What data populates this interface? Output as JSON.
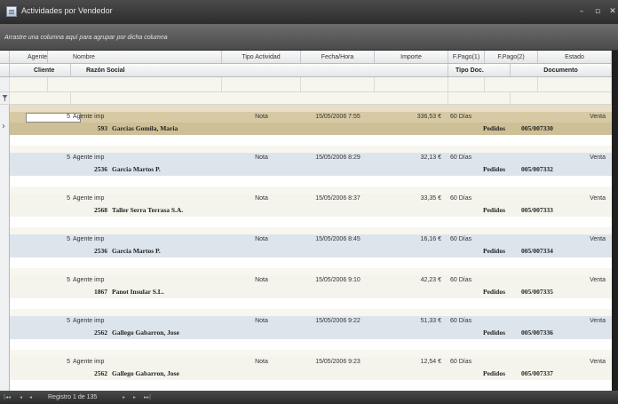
{
  "window": {
    "title": "Actividades por Vendedor",
    "minimize": "–",
    "maximize": "▫",
    "close": "✕"
  },
  "group_panel": {
    "hint": "Arrastre una columna aquí para agrupar por dicha columna"
  },
  "columns": {
    "agente": "Agente",
    "nombre": "Nombre",
    "tipo_actividad": "Tipo Actividad",
    "fecha_hora": "Fecha/Hora",
    "importe": "Importe",
    "fpago1": "F.Pago(1)",
    "fpago2": "F.Pago(2)",
    "estado": "Estado",
    "cliente": "Cliente",
    "razon_social": "Razón Social",
    "tipo_doc": "Tipo Doc.",
    "documento": "Documento"
  },
  "filter_icon": "filter-icon",
  "rows": [
    {
      "agente": "5",
      "nombre": "Agente imp",
      "tipo": "Nota",
      "fecha": "15/05/2006 7:55",
      "importe": "336,53 €",
      "fpago1": "60 Días",
      "fpago2": "",
      "estado": "Venta",
      "cliente": "593",
      "razon": "Garcias Gomila, Maria",
      "tipodoc": "Pedidos",
      "documento": "005/007330"
    },
    {
      "agente": "5",
      "nombre": "Agente imp",
      "tipo": "Nota",
      "fecha": "15/05/2006 8:29",
      "importe": "32,13 €",
      "fpago1": "60 Días",
      "fpago2": "",
      "estado": "Venta",
      "cliente": "2536",
      "razon": "Garcia Martos P.",
      "tipodoc": "Pedidos",
      "documento": "005/007332"
    },
    {
      "agente": "5",
      "nombre": "Agente imp",
      "tipo": "Nota",
      "fecha": "15/05/2006 8:37",
      "importe": "33,35 €",
      "fpago1": "60 Días",
      "fpago2": "",
      "estado": "Venta",
      "cliente": "2568",
      "razon": "Taller Serra Terrasa S.A.",
      "tipodoc": "Pedidos",
      "documento": "005/007333"
    },
    {
      "agente": "5",
      "nombre": "Agente imp",
      "tipo": "Nota",
      "fecha": "15/05/2006 8:45",
      "importe": "16,16 €",
      "fpago1": "60 Días",
      "fpago2": "",
      "estado": "Venta",
      "cliente": "2536",
      "razon": "Garcia Martos P.",
      "tipodoc": "Pedidos",
      "documento": "005/007334"
    },
    {
      "agente": "5",
      "nombre": "Agente imp",
      "tipo": "Nota",
      "fecha": "15/05/2006 9:10",
      "importe": "42,23 €",
      "fpago1": "60 Días",
      "fpago2": "",
      "estado": "Venta",
      "cliente": "1867",
      "razon": "Panot Insular S.L.",
      "tipodoc": "Pedidos",
      "documento": "005/007335"
    },
    {
      "agente": "5",
      "nombre": "Agente imp",
      "tipo": "Nota",
      "fecha": "15/05/2006 9:22",
      "importe": "51,33 €",
      "fpago1": "60 Días",
      "fpago2": "",
      "estado": "Venta",
      "cliente": "2562",
      "razon": "Gallego Gabarron, Jose",
      "tipodoc": "Pedidos",
      "documento": "005/007336"
    },
    {
      "agente": "5",
      "nombre": "Agente imp",
      "tipo": "Nota",
      "fecha": "15/05/2006 9:23",
      "importe": "12,54 €",
      "fpago1": "60 Días",
      "fpago2": "",
      "estado": "Venta",
      "cliente": "2562",
      "razon": "Gallego Gabarron, Jose",
      "tipodoc": "Pedidos",
      "documento": "005/007337"
    }
  ],
  "selected_row_indicator": "›",
  "status": {
    "record_text": "Registro 1 de 135",
    "nav_first": "|◂◂",
    "nav_prev": "◂",
    "nav_next": "▸",
    "nav_last": "▸▸|"
  },
  "colors": {
    "selected_row": "#d6c9a4",
    "alternate_row": "#dde5ec",
    "titlebar": "#2c2c2c"
  }
}
